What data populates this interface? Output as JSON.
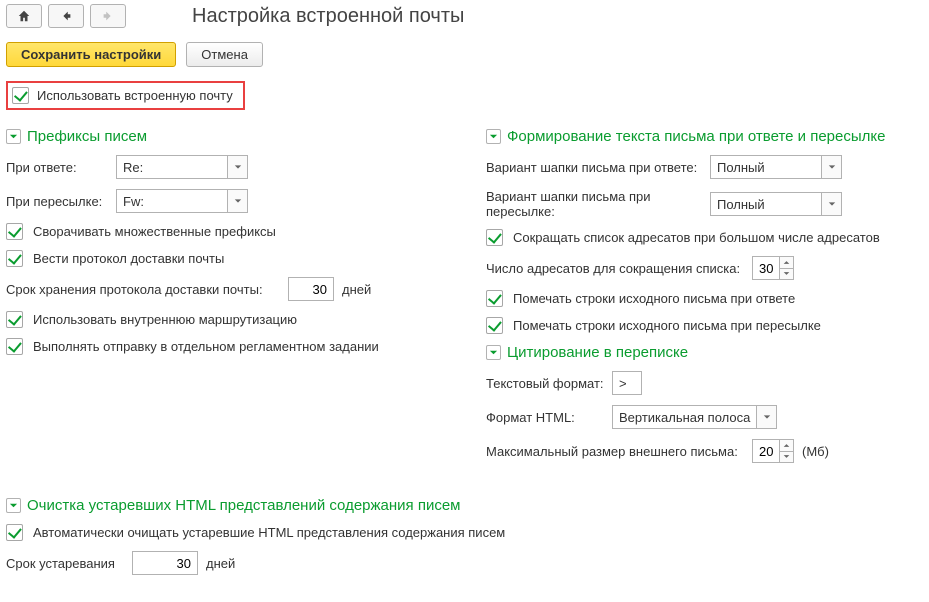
{
  "header": {
    "title": "Настройка встроенной почты"
  },
  "toolbar": {
    "save_label": "Сохранить настройки",
    "cancel_label": "Отмена"
  },
  "use_builtin_mail": {
    "label": "Использовать встроенную почту"
  },
  "prefixes": {
    "title": "Префиксы писем",
    "reply_label": "При ответе:",
    "reply_value": "Re:",
    "forward_label": "При пересылке:",
    "forward_value": "Fw:",
    "collapse_label": "Сворачивать множественные префиксы",
    "protocol_label": "Вести протокол доставки почты",
    "retention_label": "Срок хранения протокола доставки почты:",
    "retention_value": "30",
    "retention_unit": "дней",
    "routing_label": "Использовать внутреннюю маршрутизацию",
    "separate_task_label": "Выполнять отправку в отдельном регламентном задании"
  },
  "reply_fwd": {
    "title": "Формирование текста письма при ответе и пересылке",
    "reply_header_label": "Вариант шапки письма при ответе:",
    "reply_header_value": "Полный",
    "forward_header_label": "Вариант шапки письма при пересылке:",
    "forward_header_value": "Полный",
    "shorten_label": "Сокращать список адресатов при большом числе адресатов",
    "shorten_count_label": "Число адресатов для сокращения списка:",
    "shorten_count_value": "30",
    "mark_reply_label": "Помечать строки исходного письма при ответе",
    "mark_forward_label": "Помечать строки исходного письма при пересылке"
  },
  "quoting": {
    "title": "Цитирование в переписке",
    "text_format_label": "Текстовый формат:",
    "text_format_value": ">",
    "html_format_label": "Формат HTML:",
    "html_format_value": "Вертикальная полоса",
    "max_size_label": "Максимальный размер внешнего письма:",
    "max_size_value": "20",
    "max_size_unit": "(Мб)"
  },
  "cleanup": {
    "title": "Очистка устаревших HTML представлений содержания писем",
    "auto_label": "Автоматически очищать устаревшие HTML представления содержания писем",
    "age_label": "Срок устаревания",
    "age_value": "30",
    "age_unit": "дней"
  }
}
